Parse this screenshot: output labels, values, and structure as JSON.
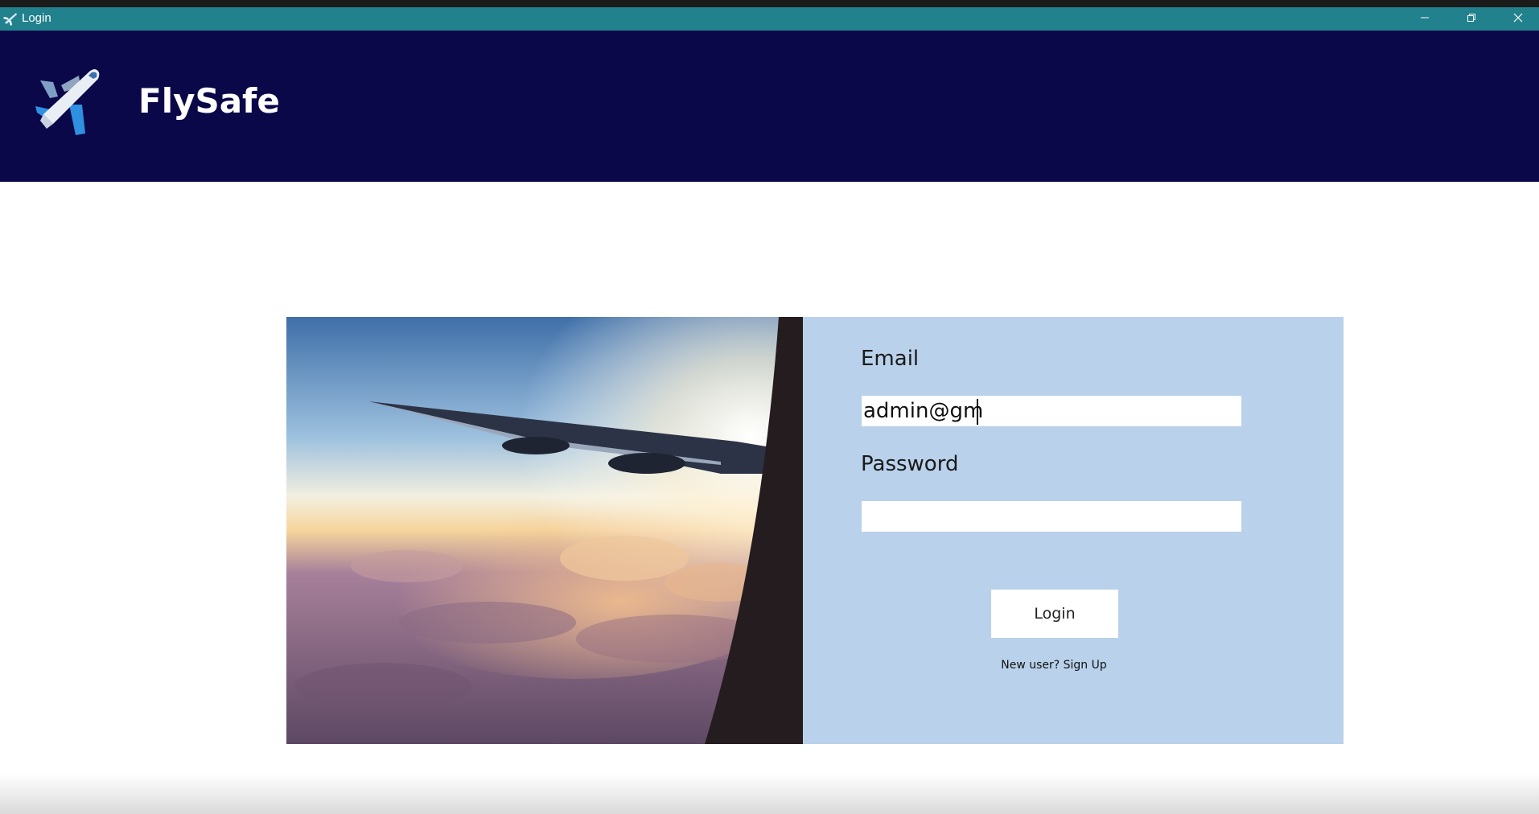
{
  "window": {
    "title": "Login",
    "icon": "airplane-icon",
    "controls": [
      "minimize-icon",
      "restore-icon",
      "close-icon"
    ]
  },
  "header": {
    "brand": "FlySafe",
    "logo_icon": "airplane-logo-icon",
    "background": "#0b0849"
  },
  "login_form": {
    "email_label": "Email",
    "email_value": "admin@gm",
    "password_label": "Password",
    "password_value": "",
    "login_button": "Login",
    "signup_link": "New user? Sign Up",
    "panel_color": "#b9d1ea"
  },
  "image": {
    "description_icon": "airplane-wing-photo"
  },
  "colors": {
    "titlebar": "#21818d",
    "header": "#0b0849",
    "panel": "#b9d1ea"
  }
}
